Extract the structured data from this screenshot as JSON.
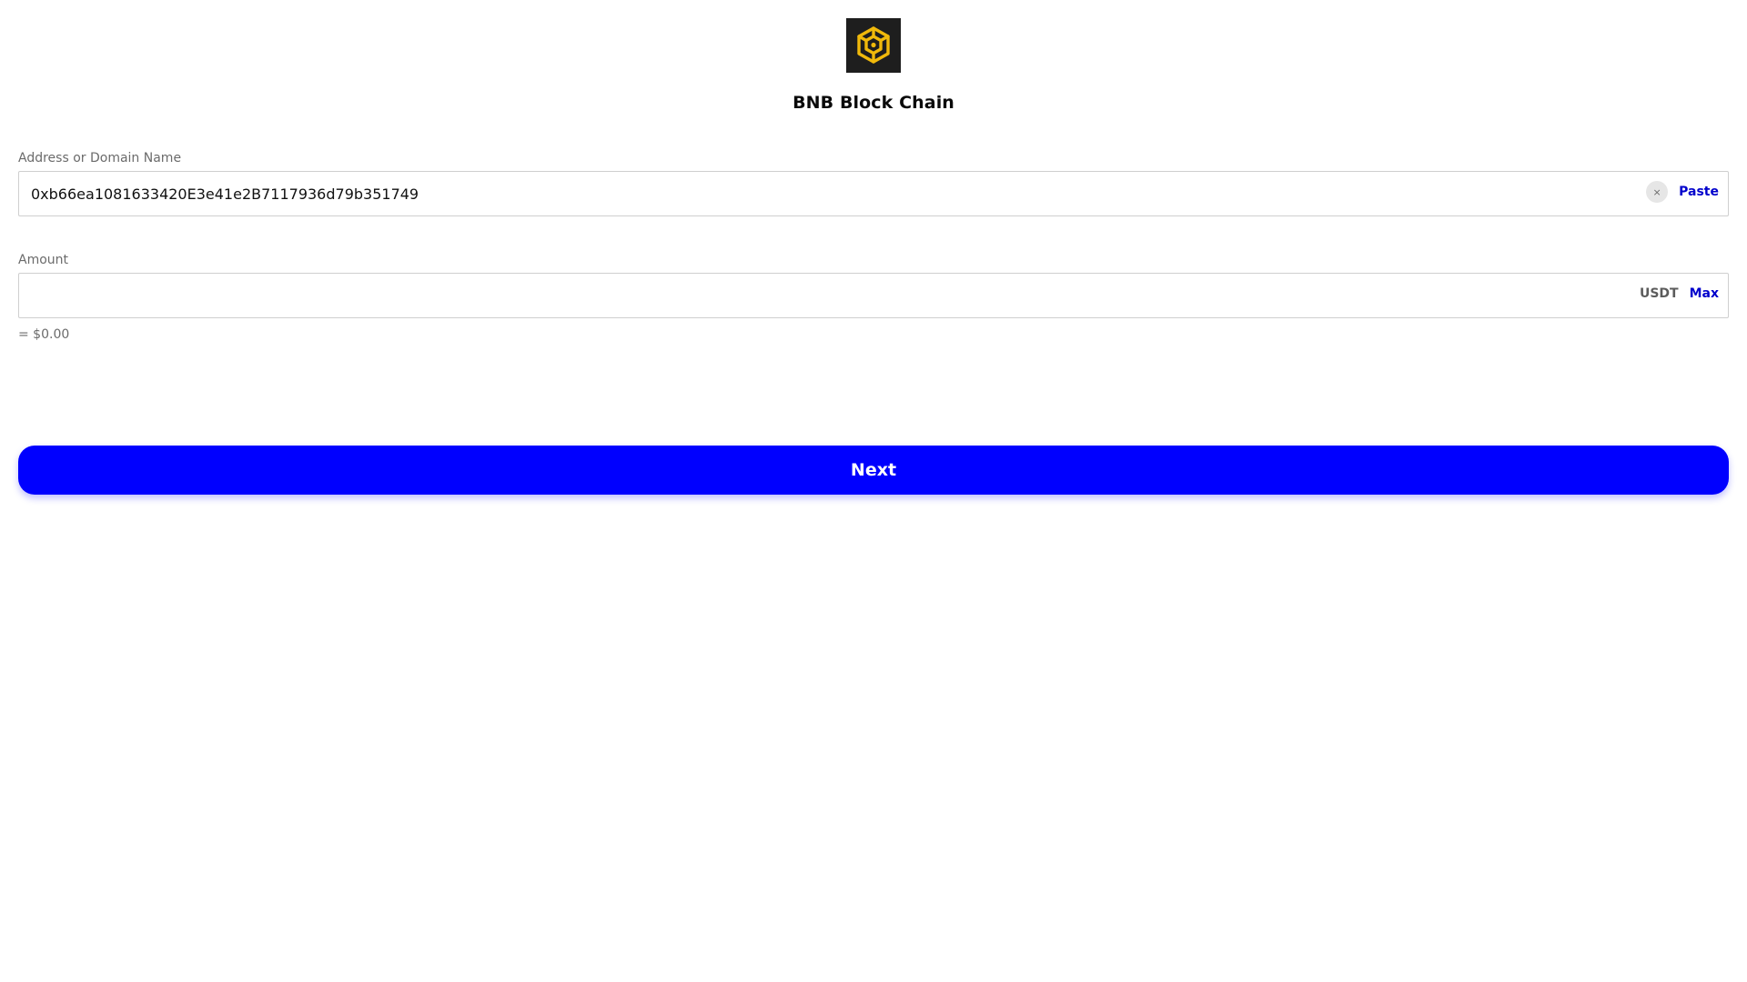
{
  "header": {
    "logo_icon": "bnb-logo-icon",
    "title": "BNB Block Chain"
  },
  "address": {
    "label": "Address or Domain Name",
    "value": "0xb66ea1081633420E3e41e2B7117936d79b351749",
    "clear_icon": "close-icon",
    "clear_glyph": "×",
    "paste_label": "Paste"
  },
  "amount": {
    "label": "Amount",
    "value": "",
    "currency": "USDT",
    "max_label": "Max",
    "fiat_value": "= $0.00"
  },
  "actions": {
    "next_label": "Next"
  },
  "colors": {
    "accent": "#0000ff",
    "link": "#0000cc",
    "logo_bg": "#1e1e1e",
    "logo_gold": "#f0b90b"
  }
}
